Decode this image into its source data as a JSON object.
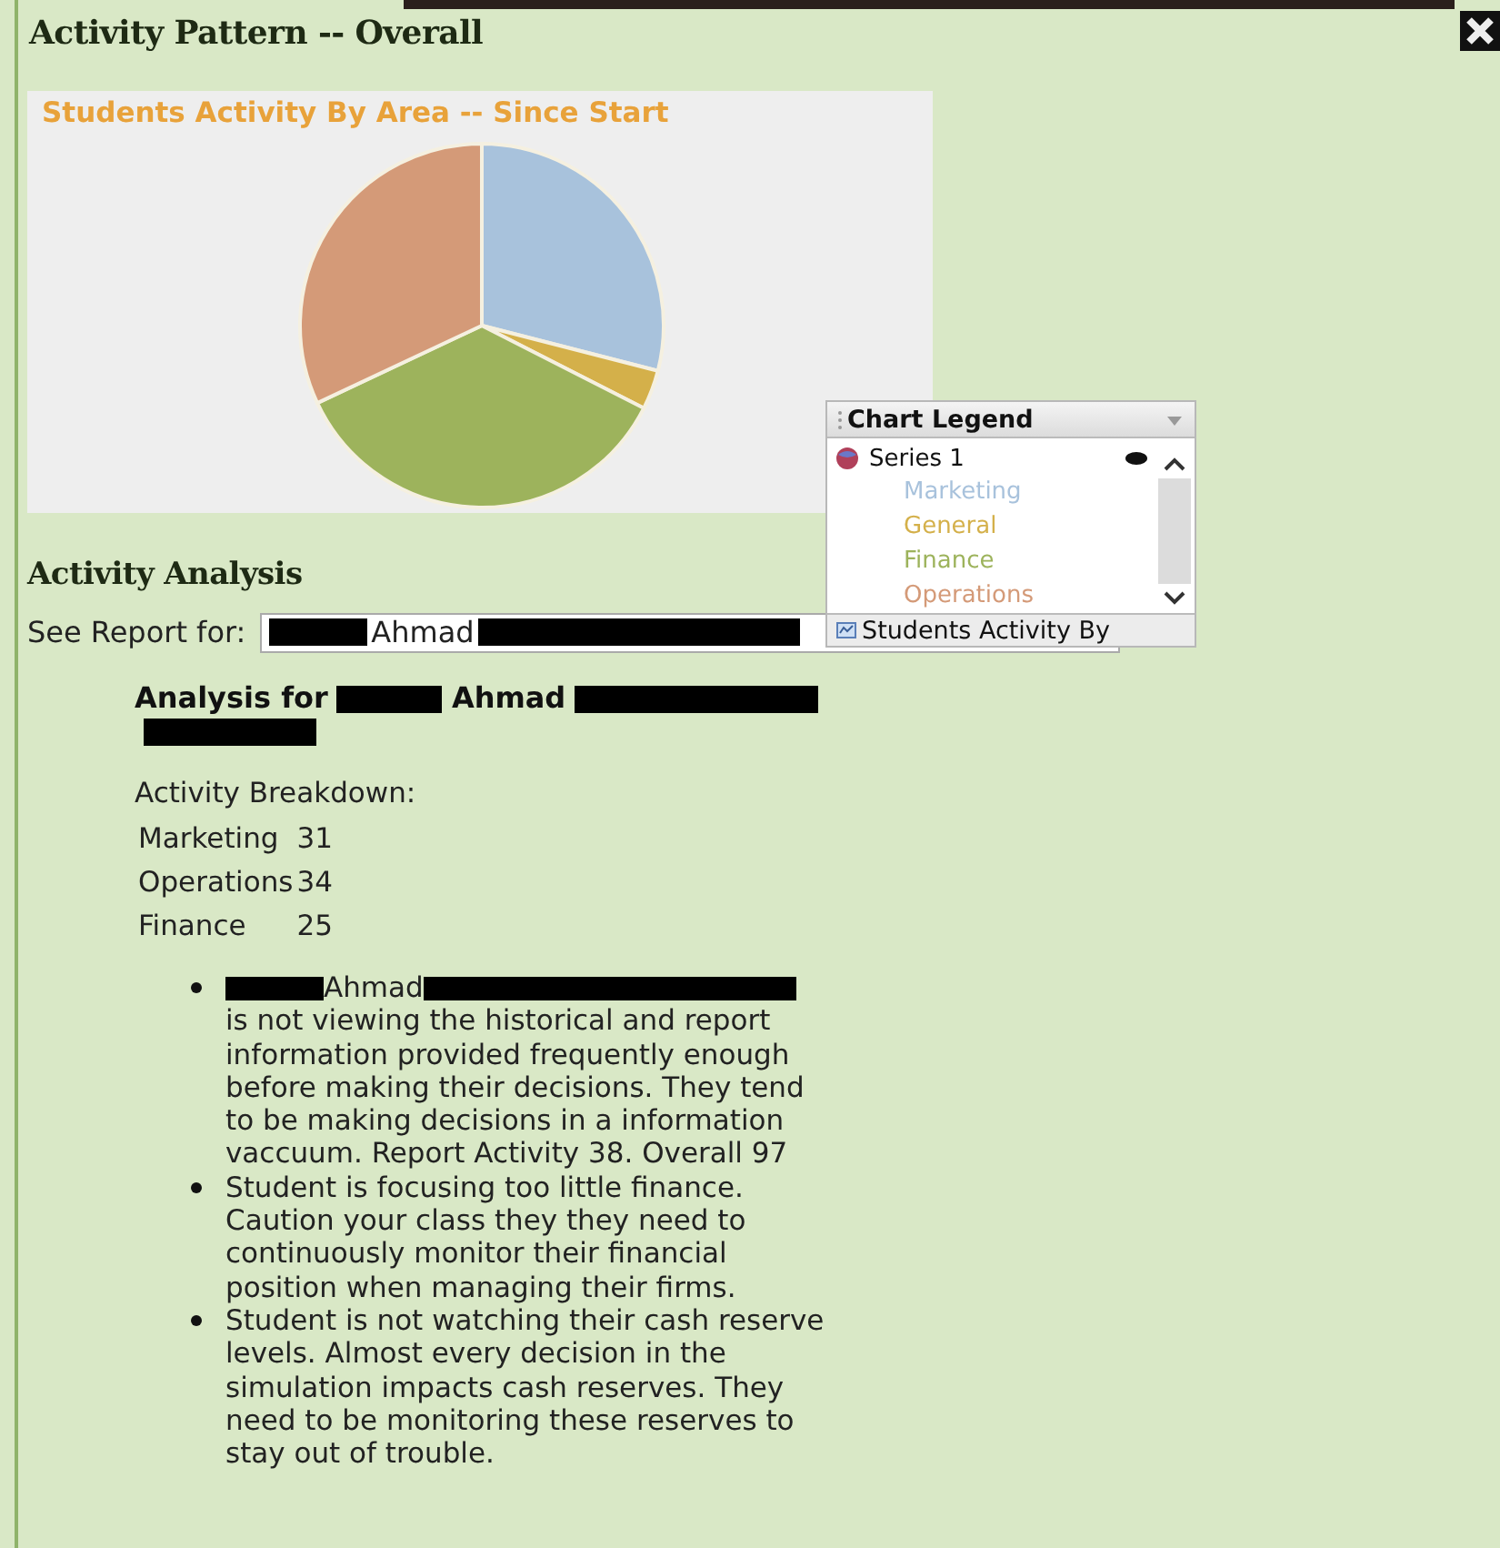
{
  "window": {
    "title": "Activity Pattern -- Overall"
  },
  "chart": {
    "title": "Students Activity By Area -- Since Start"
  },
  "legend": {
    "title": "Chart Legend",
    "series": "Series 1",
    "footer": "Students Activity By",
    "items": [
      {
        "label": "Marketing",
        "color": "#a8c2dc"
      },
      {
        "label": "General",
        "color": "#d4b04a"
      },
      {
        "label": "Finance",
        "color": "#9db35c"
      },
      {
        "label": "Operations",
        "color": "#d49a78"
      }
    ]
  },
  "analysis": {
    "heading": "Activity Analysis",
    "report_label": "See Report for:",
    "report_select": [
      {
        "kind": "redacted"
      },
      {
        "kind": "text",
        "text": "Ahmad"
      },
      {
        "kind": "redacted"
      }
    ],
    "title": [
      {
        "kind": "text",
        "text": "Analysis for"
      },
      {
        "kind": "redacted"
      },
      {
        "kind": "text",
        "text": "Ahmad"
      },
      {
        "kind": "redacted"
      },
      {
        "kind": "redacted"
      }
    ],
    "breakdown_label": "Activity Breakdown:",
    "breakdown": [
      {
        "area": "Marketing",
        "count": "31"
      },
      {
        "area": "Operations",
        "count": "34"
      },
      {
        "area": "Finance",
        "count": "25"
      }
    ],
    "notes": [
      [
        {
          "kind": "redacted"
        },
        {
          "kind": "text",
          "text": "Ahmad"
        },
        {
          "kind": "redacted"
        },
        {
          "kind": "text",
          "text": "is not viewing the historical and report information provided frequently enough before making their decisions. They tend to be making decisions in a information vaccuum. Report Activity 38. Overall 97"
        }
      ],
      [
        {
          "kind": "text",
          "text": "Student is focusing too little finance. Caution your class they they need to continuously monitor their financial position when managing their firms."
        }
      ],
      [
        {
          "kind": "text",
          "text": "Student is not watching their cash reserve levels. Almost every decision in the simulation impacts cash reserves. They need to be monitoring these reserves to stay out of trouble."
        }
      ]
    ]
  }
}
